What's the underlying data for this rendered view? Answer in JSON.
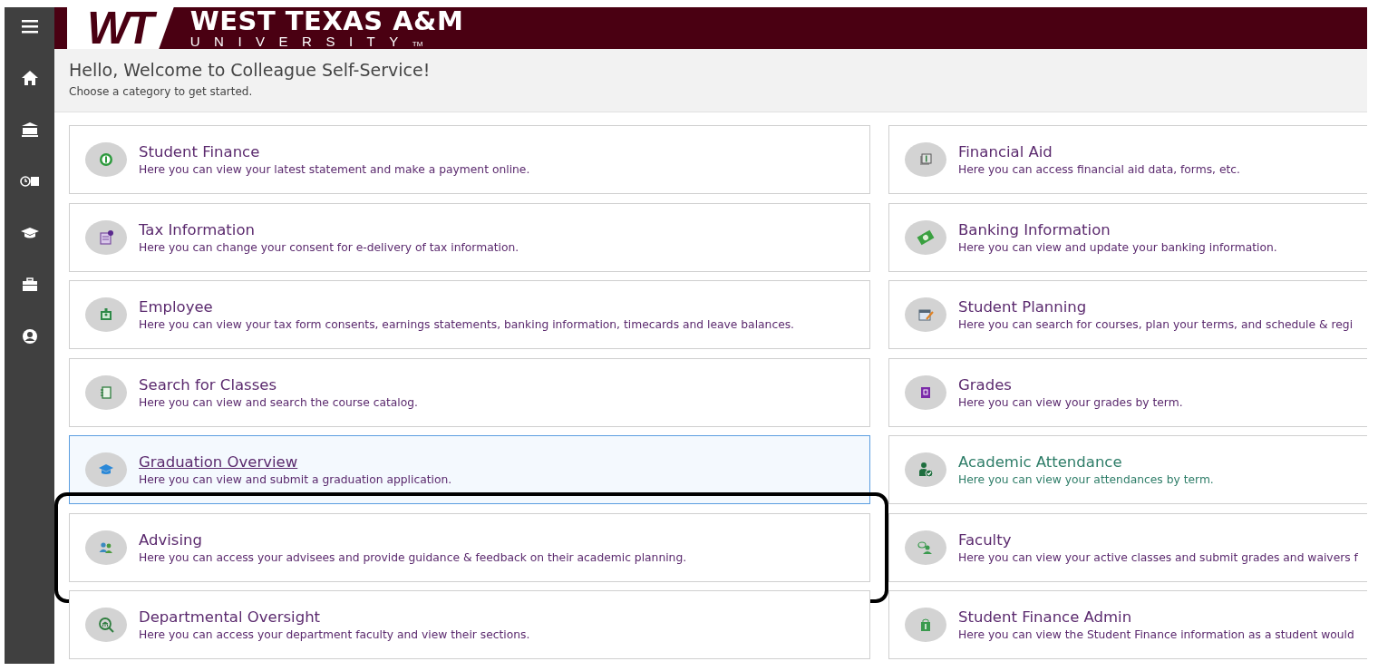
{
  "banner": {
    "monogram": "WT",
    "name": "WEST TEXAS A&M",
    "sub": "UNIVERSITY",
    "mark": "TM"
  },
  "header": {
    "title": "Hello, Welcome to Colleague Self-Service!",
    "subtitle": "Choose a category to get started."
  },
  "columns": [
    [
      {
        "kind": "coin",
        "title": "Student Finance",
        "description": "Here you can view your latest statement and make a payment online.",
        "selected": false,
        "outlined": false,
        "color": "#5b2a6e"
      },
      {
        "kind": "tax",
        "title": "Tax Information",
        "description": "Here you can change your consent for e-delivery of tax information.",
        "selected": false,
        "outlined": false,
        "color": "#5b2a6e"
      },
      {
        "kind": "badge",
        "title": "Employee",
        "description": "Here you can view your tax form consents, earnings statements, banking information, timecards and leave balances.",
        "selected": false,
        "outlined": false,
        "color": "#5b2a6e"
      },
      {
        "kind": "notebook",
        "title": "Search for Classes",
        "description": "Here you can view and search the course catalog.",
        "selected": false,
        "outlined": false,
        "color": "#5b2a6e"
      },
      {
        "kind": "cap",
        "title": "Graduation Overview",
        "description": "Here you can view and submit a graduation application.",
        "selected": true,
        "outlined": false,
        "color": "#5b2a6e"
      },
      {
        "kind": "people",
        "title": "Advising",
        "description": "Here you can access your advisees and provide guidance & feedback on their academic planning.",
        "selected": false,
        "outlined": true,
        "color": "#5b2a6e"
      },
      {
        "kind": "magnifier",
        "title": "Departmental Oversight",
        "description": "Here you can access your department faculty and view their sections.",
        "selected": false,
        "outlined": false,
        "color": "#5b2a6e"
      }
    ],
    [
      {
        "kind": "aid",
        "title": "Financial Aid",
        "description": "Here you can access financial aid data, forms, etc.",
        "selected": false,
        "outlined": false,
        "color": "#5b2a6e"
      },
      {
        "kind": "bill",
        "title": "Banking Information",
        "description": "Here you can view and update your banking information.",
        "selected": false,
        "outlined": false,
        "color": "#5b2a6e"
      },
      {
        "kind": "calendar",
        "title": "Student Planning",
        "description": "Here you can search for courses, plan your terms, and schedule & regi",
        "selected": false,
        "outlined": false,
        "color": "#5b2a6e"
      },
      {
        "kind": "grade",
        "title": "Grades",
        "description": "Here you can view your grades by term.",
        "selected": false,
        "outlined": false,
        "color": "#5b2a6e"
      },
      {
        "kind": "attendance",
        "title": "Academic Attendance",
        "description": "Here you can view your attendances by term.",
        "selected": false,
        "outlined": false,
        "color": "#2e7d68"
      },
      {
        "kind": "faculty",
        "title": "Faculty",
        "description": "Here you can view your active classes and submit grades and waivers f",
        "selected": false,
        "outlined": false,
        "color": "#5b2a6e"
      },
      {
        "kind": "bag",
        "title": "Student Finance Admin",
        "description": "Here you can view the Student Finance information as a student would",
        "selected": false,
        "outlined": false,
        "color": "#5b2a6e"
      }
    ]
  ]
}
